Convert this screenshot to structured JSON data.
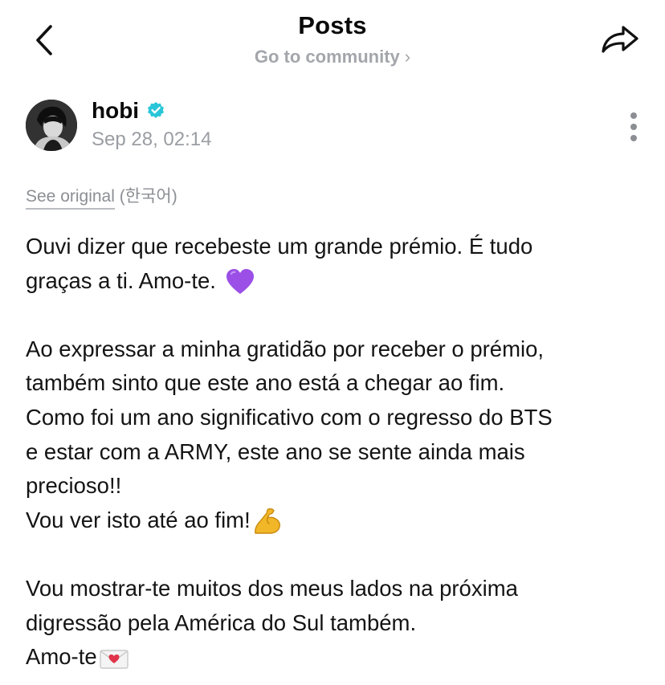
{
  "header": {
    "title": "Posts",
    "community_link": "Go to community",
    "community_chevron": "›"
  },
  "post": {
    "author_name": "hobi",
    "timestamp": "Sep 28, 02:14",
    "see_original": "See original",
    "original_language": "(한국어)",
    "lines": [
      "Ouvi dizer que recebeste um grande prémio. É tudo",
      "graças a ti. Amo-te.",
      "",
      "Ao expressar a minha gratidão por receber o prémio,",
      "também sinto que este ano está a chegar ao fim.",
      "Como foi um ano significativo com o regresso do BTS",
      "e estar com a ARMY, este ano se sente ainda mais",
      "precioso!!",
      "Vou ver isto até ao fim!",
      "",
      "Vou mostrar-te muitos dos meus lados na próxima",
      "digressão pela América do Sul também.",
      "Amo-te"
    ],
    "emojis": {
      "line_2": "purple-heart",
      "line_9": "flexed-biceps",
      "line_13": "love-letter"
    }
  },
  "icons": {
    "back": "back-chevron-icon",
    "share": "share-arrow-icon",
    "verified": "verified-badge-icon",
    "more": "more-vertical-icon"
  },
  "colors": {
    "verified_badge": "#28c6d8",
    "muted_text": "#9a9da2",
    "purple_heart": "#9b4fe6",
    "flex_arm": "#f2b728"
  }
}
